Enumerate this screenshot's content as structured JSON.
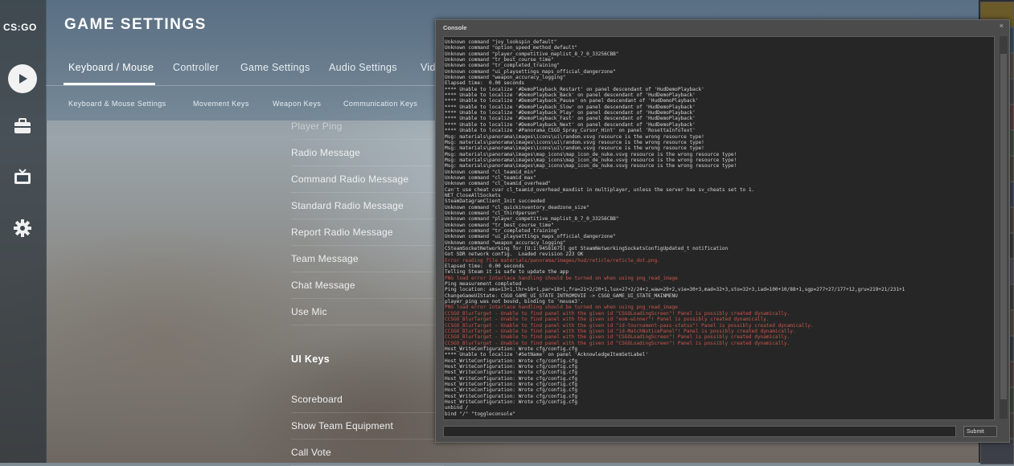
{
  "logo": "CS:GO",
  "header": {
    "title": "GAME SETTINGS",
    "tabs": [
      {
        "label": "Keyboard / Mouse",
        "active": true
      },
      {
        "label": "Controller"
      },
      {
        "label": "Game Settings"
      },
      {
        "label": "Audio Settings"
      },
      {
        "label": "Vid"
      }
    ],
    "subtabs": [
      "Keyboard & Mouse Settings",
      "Movement Keys",
      "Weapon Keys",
      "Communication Keys"
    ]
  },
  "rail": {
    "icons": [
      "play-icon",
      "briefcase-icon",
      "tv-icon",
      "gear-icon"
    ]
  },
  "list": {
    "items": [
      "Player Ping",
      "Radio Message",
      "Command Radio Message",
      "Standard Radio Message",
      "Report Radio Message",
      "Team Message",
      "Chat Message",
      "Use Mic"
    ],
    "section": "UI Keys",
    "ui_items": [
      "Scoreboard",
      "Show Team Equipment",
      "Call Vote"
    ]
  },
  "console": {
    "title": "Console",
    "close": "×",
    "submit_label": "Submit",
    "input_value": "",
    "lines": [
      {
        "t": "Unknown command \"joy_lookspin_default\""
      },
      {
        "t": "Unknown command \"option_speed_method_default\""
      },
      {
        "t": "Unknown command \"player_competitive_maplist_8_7_0_33256CBB\""
      },
      {
        "t": "Unknown command \"tr_best_course_time\""
      },
      {
        "t": "Unknown command \"tr_completed_training\""
      },
      {
        "t": "Unknown command \"ui_playsettings_maps_official_dangerzone\""
      },
      {
        "t": "Unknown command \"weapon_accuracy_logging\""
      },
      {
        "t": "Elapsed time:  0.00 seconds"
      },
      {
        "t": "**** Unable to localize '#DemoPlayback_Restart' on panel descendant of 'HudDemoPlayback'"
      },
      {
        "t": "**** Unable to localize '#DemoPlayback_Back' on panel descendant of 'HudDemoPlayback'"
      },
      {
        "t": "**** Unable to localize '#DemoPlayback_Pause' on panel descendant of 'HudDemoPlayback'"
      },
      {
        "t": "**** Unable to localize '#DemoPlayback_Slow' on panel descendant of 'HudDemoPlayback'"
      },
      {
        "t": "**** Unable to localize '#DemoPlayback_Play' on panel descendant of 'HudDemoPlayback'"
      },
      {
        "t": "**** Unable to localize '#DemoPlayback_Fast' on panel descendant of 'HudDemoPlayback'"
      },
      {
        "t": "**** Unable to localize '#DemoPlayback_Next' on panel descendant of 'HudDemoPlayback'"
      },
      {
        "t": "**** Unable to localize '#Panorama_CSGO_Spray_Cursor_Hint' on panel 'RosettaInfoText'"
      },
      {
        "t": "Msg: materials\\panorama\\images\\icons\\ui\\random.vsvg resource is the wrong resource type!"
      },
      {
        "t": "Msg: materials\\panorama\\images\\icons\\ui\\random.vsvg resource is the wrong resource type!"
      },
      {
        "t": "Msg: materials\\panorama\\images\\icons\\ui\\random.vsvg resource is the wrong resource type!"
      },
      {
        "t": "Msg: materials\\panorama\\images\\map_icons\\map_icon_de_nuke.vsvg resource is the wrong resource type!"
      },
      {
        "t": "Msg: materials\\panorama\\images\\map_icons\\map_icon_de_nuke.vsvg resource is the wrong resource type!"
      },
      {
        "t": "Msg: materials\\panorama\\images\\map_icons\\map_icon_de_nuke.vsvg resource is the wrong resource type!"
      },
      {
        "t": "Unknown command \"cl_teamid_min\""
      },
      {
        "t": "Unknown command \"cl_teamid_max\""
      },
      {
        "t": "Unknown command \"cl_teamid_overhead\""
      },
      {
        "t": "Can't use cheat cvar cl_teamid_overhead_maxdist in multiplayer, unless the server has sv_cheats set to 1."
      },
      {
        "t": "NET_CloseAllSockets"
      },
      {
        "t": "SteamDatagramClient_Init succeeded"
      },
      {
        "t": "Unknown command \"cl_quickinventory_deadzone_size\""
      },
      {
        "t": "Unknown command \"cl_thirdperson\""
      },
      {
        "t": "Unknown command \"player_competitive_maplist_8_7_0_33256CBB\""
      },
      {
        "t": "Unknown command \"tr_best_course_time\""
      },
      {
        "t": "Unknown command \"tr_completed_training\""
      },
      {
        "t": "Unknown command \"ui_playsettings_maps_official_dangerzone\""
      },
      {
        "t": "Unknown command \"weapon_accuracy_logging\""
      },
      {
        "t": "CSteamSocketNetworking for [U:1:94581675] got SteamNetworkingSocketsConfigUpdated_t notification"
      },
      {
        "t": "Got SDR network config.  Loaded revision 223 OK"
      },
      {
        "t": "Error reading file materials/panorama/images/hud/reticle/reticle_dot.png.",
        "err": true
      },
      {
        "t": "Elapsed time:  0.00 seconds"
      },
      {
        "t": "Telling Steam it is safe to update the app"
      },
      {
        "t": "PNG load error Interlace handling should be turned on when using png_read_image",
        "err": true
      },
      {
        "t": "Ping measurement completed"
      },
      {
        "t": "Ping location: ams=13+1,lhr=16+1,par=18+1,fra=21+2/20+1,lux=27+2/24+2,waw=29+2,vie=30+3,mad=32+3,sto=32+3,iad=100+10/88+1,sgp=277+27/177+12,gru=219+21/231+1"
      },
      {
        "t": "ChangeGameUIState: CSGO_GAME_UI_STATE_INTROMOVIE -> CSGO_GAME_UI_STATE_MAINMENU"
      },
      {
        "t": "player_ping was not bound, binding to 'mouse3'."
      },
      {
        "t": "PNG load error Interlace handling should be turned on when using png_read_image",
        "err": true
      },
      {
        "t": "CCSGO_BlurTarget - Unable to find panel with the given id \"CSGOLoadingScreen\"! Panel is possibly created dynamically.",
        "err": true
      },
      {
        "t": "CCSGO_BlurTarget - Unable to find panel with the given id \"eom-winner\"! Panel is possibly created dynamically.",
        "err": true
      },
      {
        "t": "CCSGO_BlurTarget - Unable to find panel with the given id \"id-tournament-pass-status\"! Panel is possibly created dynamically.",
        "err": true
      },
      {
        "t": "CCSGO_BlurTarget - Unable to find panel with the given id \"id-MatchNoticePanel\"! Panel is possibly created dynamically.",
        "err": true
      },
      {
        "t": "CCSGO_BlurTarget - Unable to find panel with the given id \"CSGOLoadingScreen\"! Panel is possibly created dynamically.",
        "err": true
      },
      {
        "t": "CCSGO_BlurTarget - Unable to find panel with the given id \"CSGOLoadingScreen\"! Panel is possibly created dynamically.",
        "err": true
      },
      {
        "t": "Host_WriteConfiguration: Wrote cfg/config.cfg"
      },
      {
        "t": "**** Unable to localize '#SetName' on panel 'AcknowledgeItemSetLabel'"
      },
      {
        "t": "Host_WriteConfiguration: Wrote cfg/config.cfg"
      },
      {
        "t": "Host_WriteConfiguration: Wrote cfg/config.cfg"
      },
      {
        "t": "Host_WriteConfiguration: Wrote cfg/config.cfg"
      },
      {
        "t": "Host_WriteConfiguration: Wrote cfg/config.cfg"
      },
      {
        "t": "Host_WriteConfiguration: Wrote cfg/config.cfg"
      },
      {
        "t": "Host_WriteConfiguration: Wrote cfg/config.cfg"
      },
      {
        "t": "Host_WriteConfiguration: Wrote cfg/config.cfg"
      },
      {
        "t": "Host_WriteConfiguration: Wrote cfg/config.cfg"
      },
      {
        "t": "unbind /"
      },
      {
        "t": "bind \"/\" \"toggleconsole\""
      }
    ]
  },
  "colors": {
    "accent": "#ffffff",
    "console_bg": "#262626",
    "console_error": "#c9574b"
  }
}
